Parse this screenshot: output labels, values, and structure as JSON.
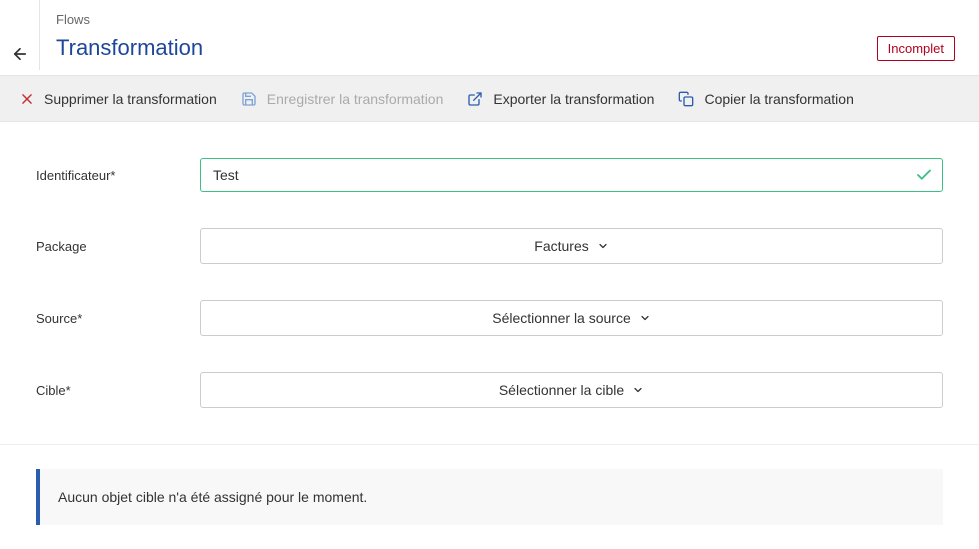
{
  "header": {
    "breadcrumb": "Flows",
    "title": "Transformation",
    "status": "Incomplet"
  },
  "toolbar": {
    "delete_label": "Supprimer la transformation",
    "save_label": "Enregistrer la transformation",
    "export_label": "Exporter la transformation",
    "copy_label": "Copier la transformation"
  },
  "form": {
    "identifier": {
      "label": "Identificateur*",
      "value": "Test"
    },
    "package": {
      "label": "Package",
      "selected": "Factures"
    },
    "source": {
      "label": "Source*",
      "placeholder": "Sélectionner la source"
    },
    "target": {
      "label": "Cible*",
      "placeholder": "Sélectionner la cible"
    }
  },
  "info": {
    "message": "Aucun objet cible n'a été assigné pour le moment."
  }
}
